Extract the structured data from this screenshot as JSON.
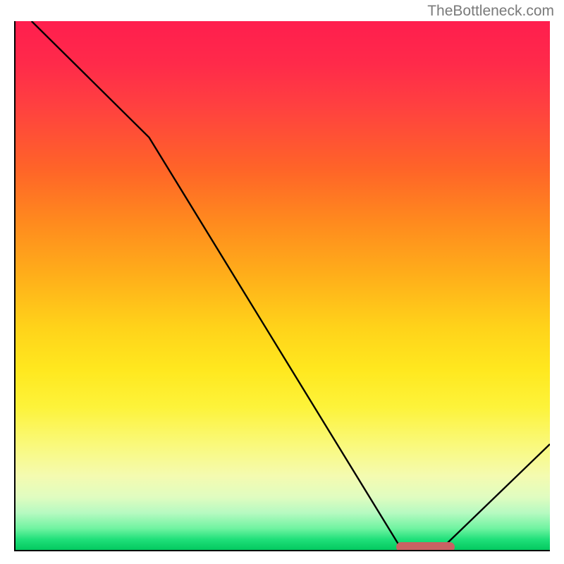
{
  "watermark": "TheBottleneck.com",
  "chart_data": {
    "type": "line",
    "title": "",
    "xlabel": "",
    "ylabel": "",
    "xlim": [
      0,
      100
    ],
    "ylim": [
      0,
      100
    ],
    "x": [
      3,
      25,
      72,
      80,
      100
    ],
    "values": [
      100,
      78,
      0.5,
      0.5,
      20
    ],
    "marker": {
      "x_start": 71,
      "x_end": 82,
      "y": 0.5
    },
    "gradient_stops": [
      {
        "pos": 0,
        "color": "#ff1e4e"
      },
      {
        "pos": 50,
        "color": "#ffd31a"
      },
      {
        "pos": 80,
        "color": "#faf97a"
      },
      {
        "pos": 100,
        "color": "#03c95f"
      }
    ]
  }
}
